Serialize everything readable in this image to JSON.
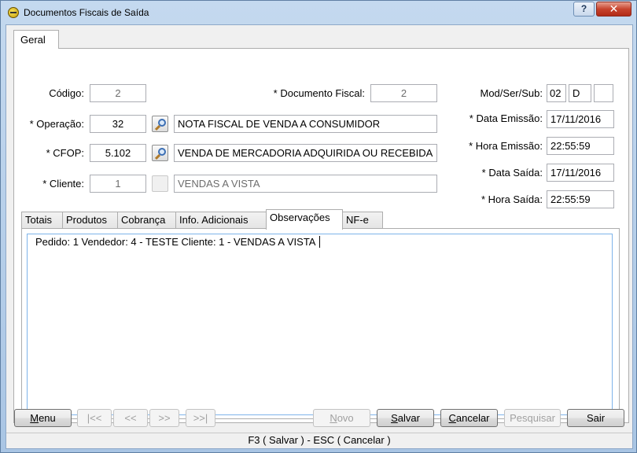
{
  "window": {
    "title": "Documentos Fiscais de Saída",
    "help_label": "?",
    "close_label": "✕"
  },
  "main_tab": {
    "label": "Geral"
  },
  "form": {
    "codigo": {
      "label": "Código:",
      "value": "2"
    },
    "documento_fiscal": {
      "label": "* Documento Fiscal:",
      "value": "2"
    },
    "mod_ser_sub": {
      "label": "Mod/Ser/Sub:",
      "mod": "02",
      "ser": "D",
      "sub": ""
    },
    "operacao": {
      "label": "* Operação:",
      "code": "32",
      "description": "NOTA FISCAL DE VENDA A CONSUMIDOR"
    },
    "data_emissao": {
      "label": "* Data Emissão:",
      "value": "17/11/2016"
    },
    "hora_emissao": {
      "label": "* Hora Emissão:",
      "value": "22:55:59"
    },
    "cfop": {
      "label": "* CFOP:",
      "code": "5.102",
      "description": "VENDA DE MERCADORIA ADQUIRIDA OU RECEBIDA"
    },
    "data_saida": {
      "label": "* Data Saída:",
      "value": "17/11/2016"
    },
    "cliente": {
      "label": "* Cliente:",
      "code": "1",
      "description": "VENDAS A VISTA"
    },
    "hora_saida": {
      "label": "* Hora Saída:",
      "value": "22:55:59"
    }
  },
  "sub_tabs": [
    {
      "label": "Totais"
    },
    {
      "label": "Produtos"
    },
    {
      "label": "Cobrança"
    },
    {
      "label": "Info. Adicionais"
    },
    {
      "label": "Observações",
      "active": true
    },
    {
      "label": "NF-e"
    }
  ],
  "observacoes": {
    "text": "Pedido: 1 Vendedor: 4 - TESTE Cliente: 1 - VENDAS A VISTA"
  },
  "buttons": {
    "menu": {
      "prefix": "",
      "hotkey": "M",
      "rest": "enu"
    },
    "first": "|<<",
    "prev": "<<",
    "next": ">>",
    "last": ">>|",
    "novo": {
      "prefix": "",
      "hotkey": "N",
      "rest": "ovo"
    },
    "salvar": {
      "prefix": "",
      "hotkey": "S",
      "rest": "alvar"
    },
    "cancelar": {
      "prefix": "",
      "hotkey": "C",
      "rest": "ancelar"
    },
    "pesquisar": "Pesquisar",
    "sair": "Sair"
  },
  "status_bar": "F3 ( Salvar )  -  ESC ( Cancelar )"
}
